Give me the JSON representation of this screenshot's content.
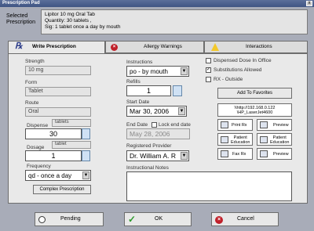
{
  "window": {
    "title": "Prescription Pad",
    "close_glyph": "x"
  },
  "selected_prescription": {
    "label_line1": "Selected",
    "label_line2": "Prescription",
    "line1": "Lipitor 10 mg Oral Tab",
    "line2": "Quantity: 30 tablets ,",
    "line3": "Sig: 1 tablet  once a day by mouth"
  },
  "tabs": [
    {
      "label": "Write Prescription",
      "icon": "rx-icon"
    },
    {
      "label": "Allergy Warnings",
      "icon": "error-icon"
    },
    {
      "label": "Interactions",
      "icon": "warning-icon"
    }
  ],
  "form": {
    "strength_label": "Strength",
    "strength_value": "10 mg",
    "form_label": "Form",
    "form_value": "Tablet",
    "route_label": "Route",
    "route_value": "Oral",
    "dispense_label": "Dispense",
    "dispense_unit": "tablets",
    "dispense_value": "30",
    "dosage_label": "Dosage",
    "dosage_unit": "tablet",
    "dosage_value": "1",
    "frequency_label": "Frequency",
    "frequency_value": "qd - once a day",
    "complex_button": "Complex Prescription",
    "instructions_label": "Instructions",
    "instructions_value": "po - by mouth",
    "refills_label": "Refills",
    "refills_value": "1",
    "start_date_label": "Start Date",
    "start_date_value": "Mar 30, 2006",
    "end_date_label": "End Date",
    "lock_end_date_label": "Lock end date",
    "end_date_value": "May 28, 2006",
    "provider_label": "Registered Provider",
    "provider_value": "Dr. William A. R",
    "instructional_notes_label": "Instructional Notes"
  },
  "options": {
    "dispensed_in_office": "Dispensed Dose In Office",
    "substitutions_allowed": "Substitutions Allowed",
    "rx_outside": "RX - Outside",
    "substitutions_checked": true,
    "add_favorites": "Add To Favorites",
    "printer_line1": "\\\\http://192.168.0.122",
    "printer_line2": "\\HP_LaserJet4600"
  },
  "print_buttons": [
    {
      "label": "Print Rx",
      "label2": ""
    },
    {
      "label": "Preview",
      "label2": ""
    },
    {
      "label": "Patient",
      "label2": "Education"
    },
    {
      "label": "Patient",
      "label2": "Education"
    },
    {
      "label": "Fax Rx",
      "label2": ""
    },
    {
      "label": "Preview",
      "label2": ""
    }
  ],
  "footer": {
    "pending": "Pending",
    "ok": "OK",
    "cancel": "Cancel"
  },
  "colors": {
    "accent_tab": "#a8acb8",
    "ok_green": "#2c9a2c",
    "cancel_red": "#c0202a",
    "warning_yellow": "#f3c82a"
  }
}
